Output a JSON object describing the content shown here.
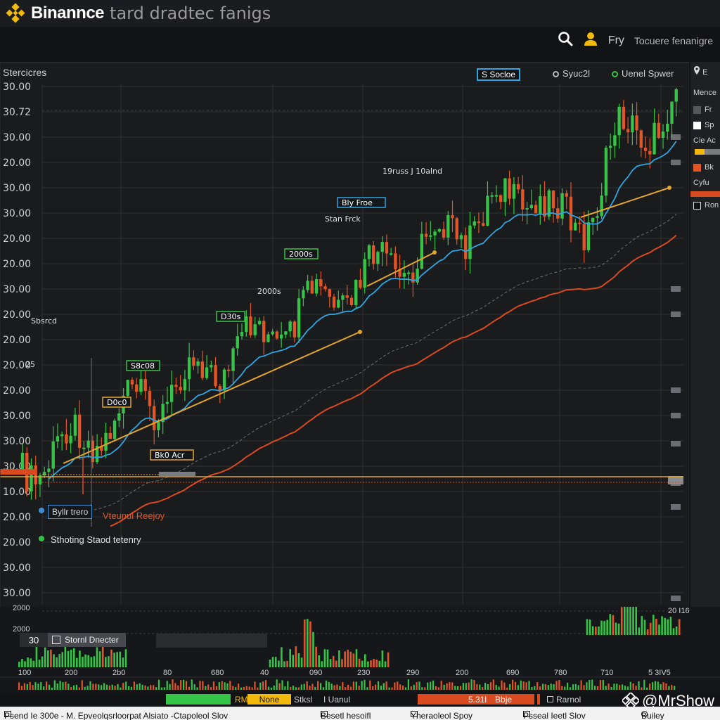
{
  "header": {
    "brand": "Binannce",
    "title": "tard dradtec fanigs",
    "brand_color": "#f0b90b"
  },
  "subbar": {
    "user_label": "Fry",
    "settings_label": "Tocuere fenanigre",
    "icons": [
      "search-icon",
      "user-icon"
    ]
  },
  "chart_panel": {
    "title": "Stercicres",
    "indicator_box": "S Socloe",
    "indicator_sync": "Syuc2l",
    "indicator_green": "Uenel Spwer"
  },
  "right_panel": {
    "items": [
      "E",
      "Mence",
      "Fr",
      "Sp",
      "Cie Ac",
      "Bk",
      "Cyfu",
      "Ron"
    ]
  },
  "legend": {
    "box": "Byllr trero",
    "red": "Vteunul Reejoy",
    "green": "Sthoting Staod tetenry"
  },
  "volume_panel": {
    "top_left": "2000",
    "left2": "2000",
    "right_label": "20 I16",
    "tab_number": "30",
    "tab_name": "Stornl Dnecter",
    "x_labels": [
      "100",
      "200",
      "2b0",
      "80",
      "680",
      "40",
      "090",
      "230",
      "290",
      "200",
      "690",
      "780",
      "710",
      "5 3IV5"
    ]
  },
  "status_strip": {
    "seg1": "RM",
    "seg2": "None",
    "seg3": "Stksl",
    "seg4": "I Uanul",
    "seg5": "5.31l",
    "seg6": "Bbje",
    "seg7": "Rarnol"
  },
  "footer": {
    "items": [
      "Psend Ie 300e - M. Epveolqsrloorpat Alsiato -Ctapoleol Slov",
      "Besetl hesoifl",
      "Yheraoleol Spoy",
      "Psseal Ieetl Slov",
      "Builey"
    ]
  },
  "watermark": "@MrShow",
  "colors": {
    "up": "#36c447",
    "down": "#e25527",
    "ema_fast": "#2fa6e0",
    "ema_slow": "#d94a20",
    "trend": "#e3a52b",
    "grid": "#2f3034"
  },
  "chart_data": {
    "type": "candlestick",
    "y_tick_labels": [
      "30.00",
      "30.72",
      "30.00",
      "20.00",
      "30.00",
      "30.00",
      "20.00",
      "20.00",
      "30.00",
      "20.00",
      "20.00",
      "20.00",
      "20.00",
      "30.00",
      "30.00",
      "30.00",
      "10.00",
      "20.00",
      "20.00",
      "30.00",
      "30.00"
    ],
    "annotations": [
      "S8c08",
      "D0c0",
      "Bk0 Acr",
      "D30s",
      "2000s",
      "Bly Froe",
      "Stan Frck",
      "19russ J 10aInd",
      "Sbsrcd",
      "25"
    ],
    "series": [
      {
        "name": "Price",
        "close_trend": "up"
      }
    ],
    "grid": true,
    "legend": "top-right"
  }
}
